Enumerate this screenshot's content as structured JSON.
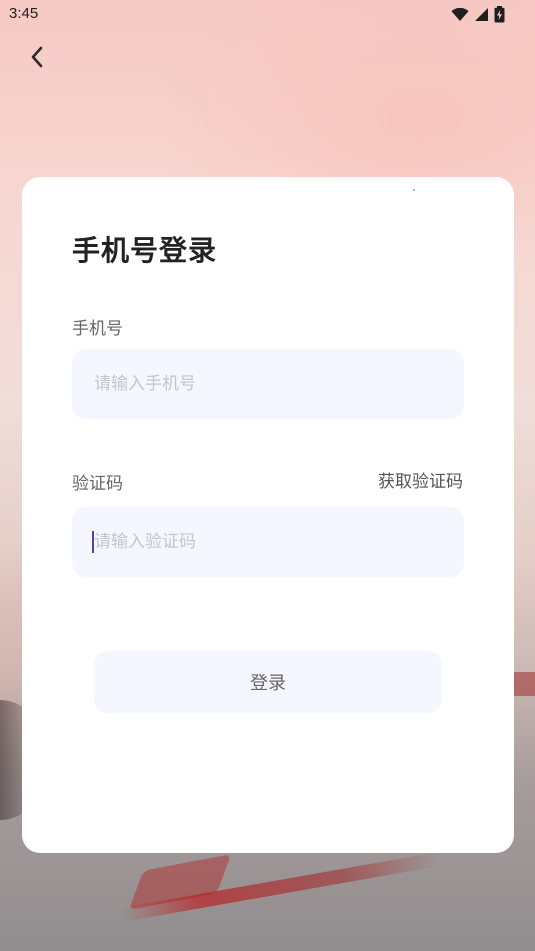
{
  "status_bar": {
    "time": "3:45",
    "icons": [
      "wifi-icon",
      "signal-icon",
      "battery-charging-icon"
    ]
  },
  "nav": {
    "back_icon": "chevron-left-icon"
  },
  "login_card": {
    "title": "手机号登录",
    "phone": {
      "label": "手机号",
      "placeholder": "请输入手机号",
      "value": ""
    },
    "code": {
      "label": "验证码",
      "placeholder": "请输入验证码",
      "value": "",
      "get_code_label": "获取验证码"
    },
    "login_button_label": "登录"
  },
  "colors": {
    "input_bg": "#f4f7ff",
    "caret": "#5a3fa8",
    "title": "#222222"
  }
}
